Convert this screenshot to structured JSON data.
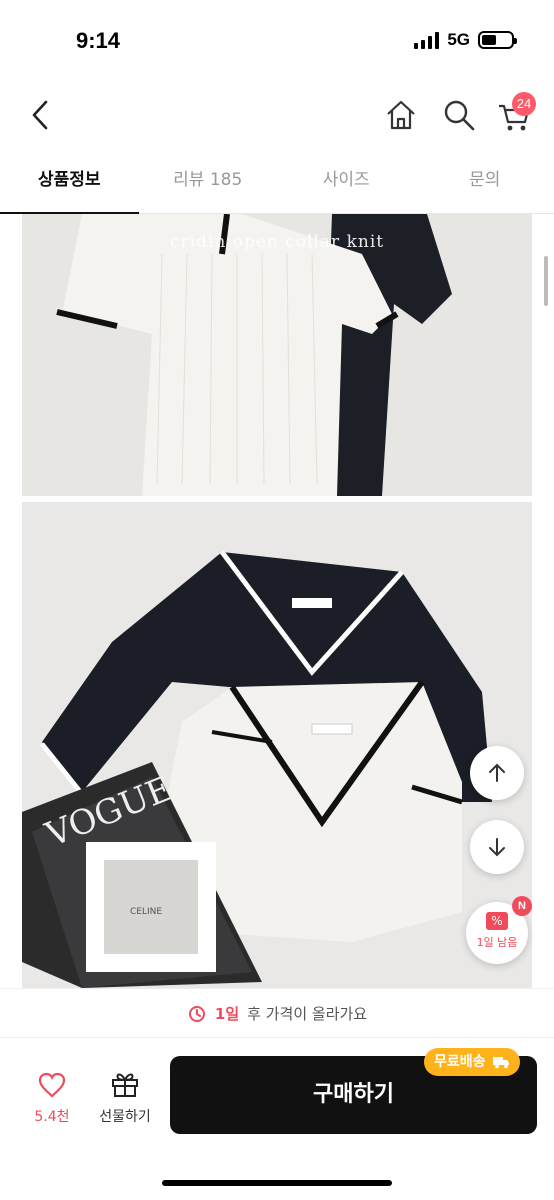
{
  "status": {
    "time": "9:14",
    "network": "5G"
  },
  "nav": {
    "cart_count": "24"
  },
  "tabs": [
    {
      "label": "상품정보"
    },
    {
      "label": "리뷰 185"
    },
    {
      "label": "사이즈"
    },
    {
      "label": "문의"
    }
  ],
  "content": {
    "image1_caption": "cridin open collar knit",
    "magazine_text": "VOGUE",
    "label_tag": "CELINE"
  },
  "floating": {
    "coupon_label": "1일 남음",
    "coupon_badge": "N"
  },
  "notice": {
    "highlight": "1일",
    "text": "후 가격이 올라가요"
  },
  "bottom": {
    "like_count": "5.4천",
    "gift_label": "선물하기",
    "buy_label": "구매하기",
    "shipping_badge": "무료배송"
  },
  "colors": {
    "accent": "#f14a5b",
    "buy_bg": "#111111",
    "shipping": "#ffb21a"
  }
}
